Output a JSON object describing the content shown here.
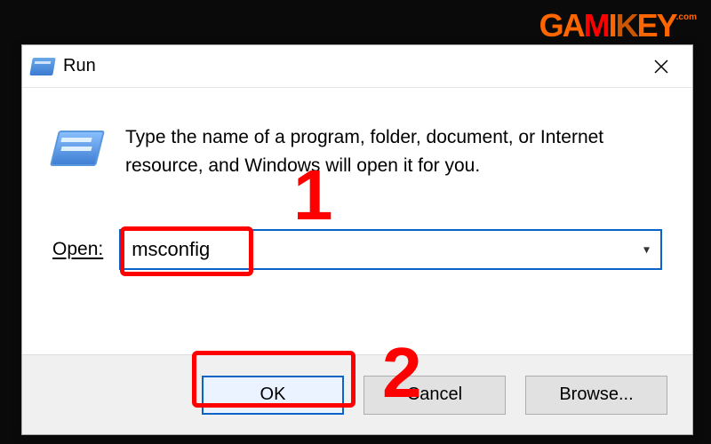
{
  "watermark": {
    "text": "GAMIKEY",
    "sub": ".com"
  },
  "dialog": {
    "title": "Run",
    "instruction": "Type the name of a program, folder, document, or Internet resource, and Windows will open it for you.",
    "open_label": "Open:",
    "input_value": "msconfig",
    "buttons": {
      "ok": "OK",
      "cancel": "Cancel",
      "browse": "Browse..."
    }
  },
  "annotations": {
    "step1": "1",
    "step2": "2"
  }
}
